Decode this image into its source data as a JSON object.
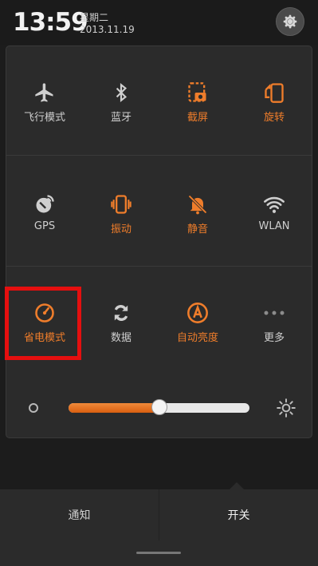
{
  "status": {
    "time": "13:59",
    "weekday": "星期二",
    "date": "2013.11.19"
  },
  "settings_icon": "gear-icon",
  "tiles": [
    {
      "label": "飞行模式",
      "icon": "airplane-icon",
      "state": "off"
    },
    {
      "label": "蓝牙",
      "icon": "bluetooth-icon",
      "state": "off"
    },
    {
      "label": "截屏",
      "icon": "screenshot-icon",
      "state": "on"
    },
    {
      "label": "旋转",
      "icon": "rotate-icon",
      "state": "on"
    },
    {
      "label": "GPS",
      "icon": "gps-icon",
      "state": "off"
    },
    {
      "label": "振动",
      "icon": "vibrate-icon",
      "state": "on"
    },
    {
      "label": "静音",
      "icon": "mute-icon",
      "state": "on"
    },
    {
      "label": "WLAN",
      "icon": "wifi-icon",
      "state": "off"
    },
    {
      "label": "省电模式",
      "icon": "power-saving-icon",
      "state": "on"
    },
    {
      "label": "数据",
      "icon": "data-icon",
      "state": "off"
    },
    {
      "label": "自动亮度",
      "icon": "auto-brightness-icon",
      "state": "on"
    },
    {
      "label": "更多",
      "icon": "more-icon",
      "state": "off"
    }
  ],
  "brightness": {
    "level_fraction": 0.5,
    "min_icon": "brightness-low-icon",
    "max_icon": "brightness-high-icon"
  },
  "bottom_tabs": [
    {
      "label": "通知",
      "selected": false
    },
    {
      "label": "开关",
      "selected": true
    }
  ],
  "colors": {
    "accent": "#ef7d2b",
    "inactive": "#cfcfcf",
    "panel": "#2b2b2b",
    "highlight": "#e50f0f"
  }
}
